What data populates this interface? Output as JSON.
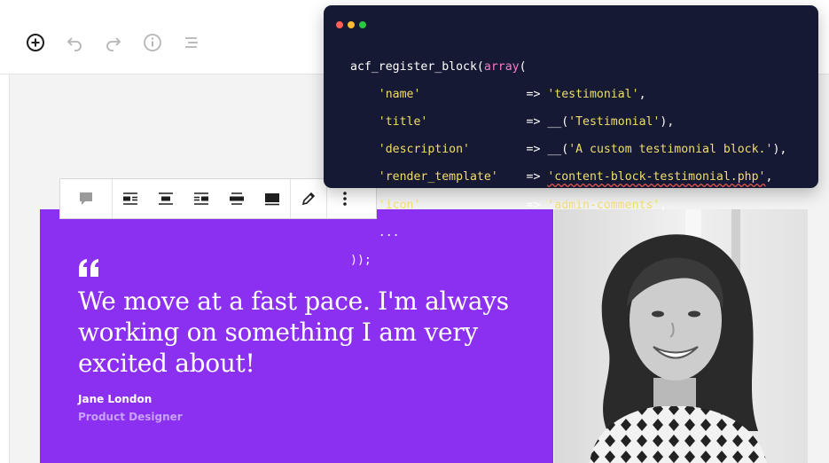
{
  "editor_toolbar": {
    "icons": [
      "add-block-icon",
      "undo-icon",
      "redo-icon",
      "info-icon",
      "outline-icon"
    ]
  },
  "block_toolbar": {
    "icons": [
      "comment-block-icon",
      "align-left-icon",
      "align-center-icon",
      "align-right-icon",
      "align-wide-icon",
      "align-full-icon",
      "edit-pencil-icon",
      "more-options-icon"
    ]
  },
  "testimonial": {
    "quote": "We move at a fast pace. I'm always working on something I am very excited about!",
    "name": "Jane London",
    "role": "Product Designer",
    "colors": {
      "background": "#8b2ff0",
      "role_text": "#c9a0ff"
    }
  },
  "code_window": {
    "traffic_lights": [
      "#ff5f57",
      "#febc2e",
      "#28c840"
    ],
    "lines": [
      {
        "fn": "acf_register_block",
        "open": "(",
        "kw": "array",
        "rest": "("
      },
      {
        "key": "'name'",
        "pad": "               ",
        "arrow": "=>",
        "val": "'testimonial'",
        "end": ","
      },
      {
        "key": "'title'",
        "pad": "              ",
        "arrow": "=>",
        "pre": "__(",
        "val": "'Testimonial'",
        "end": "),"
      },
      {
        "key": "'description'",
        "pad": "        ",
        "arrow": "=>",
        "pre": "__(",
        "val": "'A custom testimonial block.'",
        "end": "),"
      },
      {
        "key": "'render_template'",
        "pad": "    ",
        "arrow": "=>",
        "val": "'content-block-testimonial.php'",
        "end": ","
      },
      {
        "key": "'icon'",
        "pad": "               ",
        "arrow": "=>",
        "val": "'admin-comments'",
        "end": ","
      },
      {
        "plain": "    ..."
      },
      {
        "plain": "));"
      }
    ]
  }
}
